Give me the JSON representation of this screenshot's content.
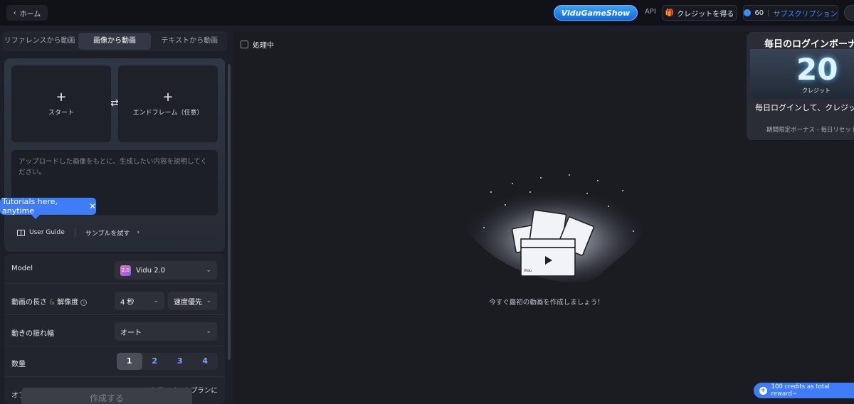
{
  "topbar": {
    "home_label": "ホーム",
    "brand": "ViduGameShow",
    "api_label": "API",
    "get_credits_label": "クレジットを得る",
    "credits_count": "60",
    "subscription_label": "サブスクリプション"
  },
  "tabs": [
    {
      "label": "リファレンスから動画"
    },
    {
      "label": "画像から動画"
    },
    {
      "label": "テキストから動画"
    }
  ],
  "upload": {
    "start_label": "スタート",
    "end_label": "エンドフレーム（任意）",
    "prompt_placeholder": "アップロードした画像をもとに、生成したい内容を説明してください。",
    "user_guide_label": "User Guide",
    "try_sample_label": "サンプルを試す"
  },
  "tutorial_tip": {
    "text": "Tutorials here, anytime"
  },
  "settings": {
    "model_label": "Model",
    "model_value": "Vidu 2.0",
    "model_badge": "2.0",
    "length_label": "動画の長さ",
    "amp": "&",
    "resolution_label": "解像度",
    "length_value": "4 秒",
    "resolution_value": "速度優先",
    "motion_label": "動きの振れ幅",
    "motion_value": "オート",
    "quantity_label": "数量",
    "quantities": [
      "1",
      "2",
      "3",
      "4"
    ],
    "selected_quantity": "1",
    "more_label": "オフ",
    "more_note": "アルティメットプランに"
  },
  "create_label": "作成する",
  "main": {
    "processing_label": "処理中",
    "empty_text": "今すぐ最初の動画を作成しましょう！"
  },
  "bonus": {
    "title": "毎日のログインボーナス",
    "amount": "20",
    "unit": "クレジット",
    "desc": "毎日ログインして、クレジット!",
    "sub": "期間限定ボーナス - 毎日リセット"
  },
  "reward_pill": {
    "text": "100 credits as total reward~"
  },
  "colors": {
    "accent": "#3f7cf7",
    "brand": "#1e88ff",
    "background": "#1c1f27"
  }
}
